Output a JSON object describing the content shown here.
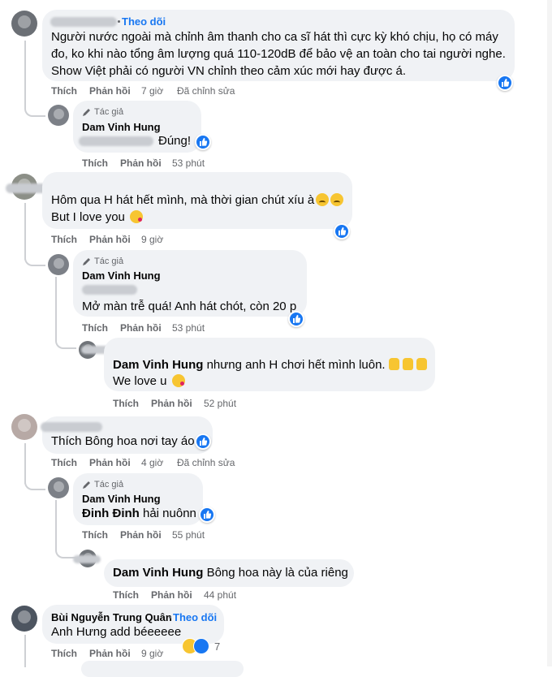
{
  "comments": [
    {
      "follow_label": "Theo dõi",
      "text_lines": [
        "Người nước ngoài mà chỉnh âm thanh cho ca sĩ hát thì cực kỳ khó chịu, họ có máy",
        "đo, ko khi nào tổng âm lượng quá 110-120dB để bảo vệ an toàn cho tai người nghe.",
        "Show Việt phải có người VN chỉnh theo cảm xúc mới hay được á."
      ],
      "like_label": "Thích",
      "reply_label": "Phản hồi",
      "time": "7 giờ",
      "edited": "Đã chỉnh sửa",
      "replies": [
        {
          "author_tag": "Tác giả",
          "author": "Dam Vinh Hung",
          "text": "Đúng!",
          "like_label": "Thích",
          "reply_label": "Phản hồi",
          "time": "53 phút"
        }
      ]
    },
    {
      "text_lines": [
        "Hôm qua H hát hết mình, mà thời gian chút xíu à",
        "But I love you"
      ],
      "like_label": "Thích",
      "reply_label": "Phản hồi",
      "time": "9 giờ",
      "replies": [
        {
          "author_tag": "Tác giả",
          "author": "Dam Vinh Hung",
          "text": "Mở màn trễ quá! Anh hát chót, còn 20 p",
          "like_label": "Thích",
          "reply_label": "Phản hồi",
          "time": "53 phút"
        },
        {
          "mention": "Dam Vinh Hung",
          "text": "nhưng anh H chơi hết mình luôn.",
          "text2": "We love u",
          "like_label": "Thích",
          "reply_label": "Phản hồi",
          "time": "52 phút"
        }
      ]
    },
    {
      "text": "Thích Bông hoa nơi tay áo",
      "like_label": "Thích",
      "reply_label": "Phản hồi",
      "time": "4 giờ",
      "edited": "Đã chỉnh sửa",
      "replies": [
        {
          "author_tag": "Tác giả",
          "author": "Dam Vinh Hung",
          "mention": "Đinh Đinh",
          "text": "hải nuônn",
          "like_label": "Thích",
          "reply_label": "Phản hồi",
          "time": "55 phút"
        },
        {
          "mention": "Dam Vinh Hung",
          "text": "Bông hoa này là của riêng",
          "like_label": "Thích",
          "reply_label": "Phản hồi",
          "time": "44 phút"
        }
      ]
    },
    {
      "author": "Bùi Nguyễn Trung Quân",
      "follow_label": "Theo dõi",
      "text": "Anh Hưng add béeeeee",
      "like_label": "Thích",
      "reply_label": "Phản hồi",
      "time": "9 giờ",
      "reaction_count": "7"
    }
  ],
  "colors": {
    "bubble": "#f0f2f5",
    "link_blue": "#1877f2",
    "meta_gray": "#65676b",
    "like_blue": "#1877f2"
  },
  "icons": {
    "author": "pencil-icon",
    "like": "thumbs-up-icon",
    "haha": "laughing-emoji-icon"
  }
}
